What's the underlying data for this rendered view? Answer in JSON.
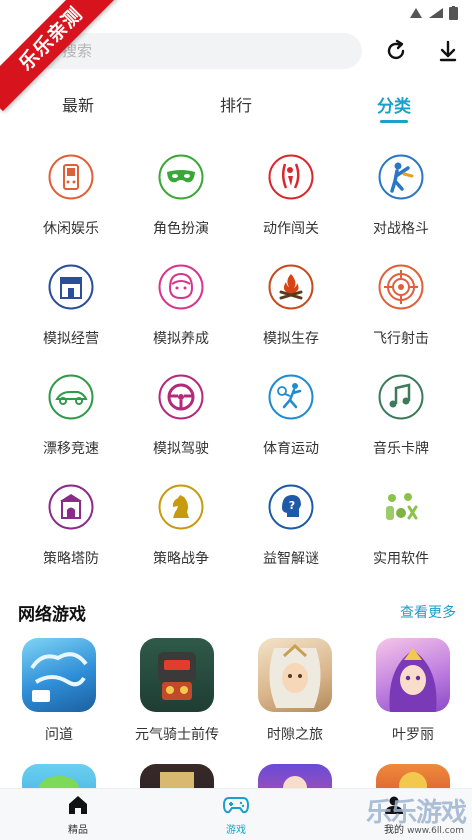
{
  "corner_banner": {
    "text": "乐乐亲测"
  },
  "search": {
    "placeholder": "搜索"
  },
  "tabs": [
    {
      "label": "最新",
      "active": false
    },
    {
      "label": "排行",
      "active": false
    },
    {
      "label": "分类",
      "active": true
    }
  ],
  "categories": [
    {
      "label": "休闲娱乐",
      "icon": "handheld-console-icon",
      "color": "#e0603a"
    },
    {
      "label": "角色扮演",
      "icon": "mask-icon",
      "color": "#3aa838"
    },
    {
      "label": "动作闯关",
      "icon": "fighter-icon",
      "color": "#d7282e"
    },
    {
      "label": "对战格斗",
      "icon": "kick-icon",
      "color": "#2b77c4"
    },
    {
      "label": "模拟经营",
      "icon": "shop-icon",
      "color": "#2a4f9a"
    },
    {
      "label": "模拟养成",
      "icon": "girl-icon",
      "color": "#d8358a"
    },
    {
      "label": "模拟生存",
      "icon": "campfire-icon",
      "color": "#c74a1c"
    },
    {
      "label": "飞行射击",
      "icon": "target-icon",
      "color": "#e0603a"
    },
    {
      "label": "漂移竞速",
      "icon": "race-car-icon",
      "color": "#2f9a4a"
    },
    {
      "label": "模拟驾驶",
      "icon": "steering-wheel-icon",
      "color": "#b4297a"
    },
    {
      "label": "体育运动",
      "icon": "tennis-icon",
      "color": "#1e8cd0"
    },
    {
      "label": "音乐卡牌",
      "icon": "music-note-icon",
      "color": "#3c7a5a"
    },
    {
      "label": "策略塔防",
      "icon": "tower-icon",
      "color": "#8a2a8a"
    },
    {
      "label": "策略战争",
      "icon": "chess-knight-icon",
      "color": "#c89a10"
    },
    {
      "label": "益智解谜",
      "icon": "question-head-icon",
      "color": "#1e5aa8"
    },
    {
      "label": "实用软件",
      "icon": "tools-icon",
      "color": "#8bc34a"
    }
  ],
  "section": {
    "title": "网络游戏",
    "more": "查看更多"
  },
  "games": [
    {
      "name": "问道",
      "icon": "wendao-game-icon",
      "color": "#3a9ad9"
    },
    {
      "name": "元气骑士前传",
      "icon": "soul-knight-icon",
      "color": "#2f5a4a"
    },
    {
      "name": "时隙之旅",
      "icon": "time-journey-icon",
      "color": "#d9b48a"
    },
    {
      "name": "叶罗丽",
      "icon": "yeloli-icon",
      "color": "#a66ad8"
    }
  ],
  "bottom_nav": [
    {
      "label": "精品",
      "icon": "home-icon",
      "active": false
    },
    {
      "label": "游戏",
      "icon": "gamepad-icon",
      "active": true
    },
    {
      "label": "我的",
      "icon": "user-icon",
      "active": false
    }
  ],
  "watermark": {
    "text": "乐乐游戏",
    "url": "www.6ll.com"
  }
}
